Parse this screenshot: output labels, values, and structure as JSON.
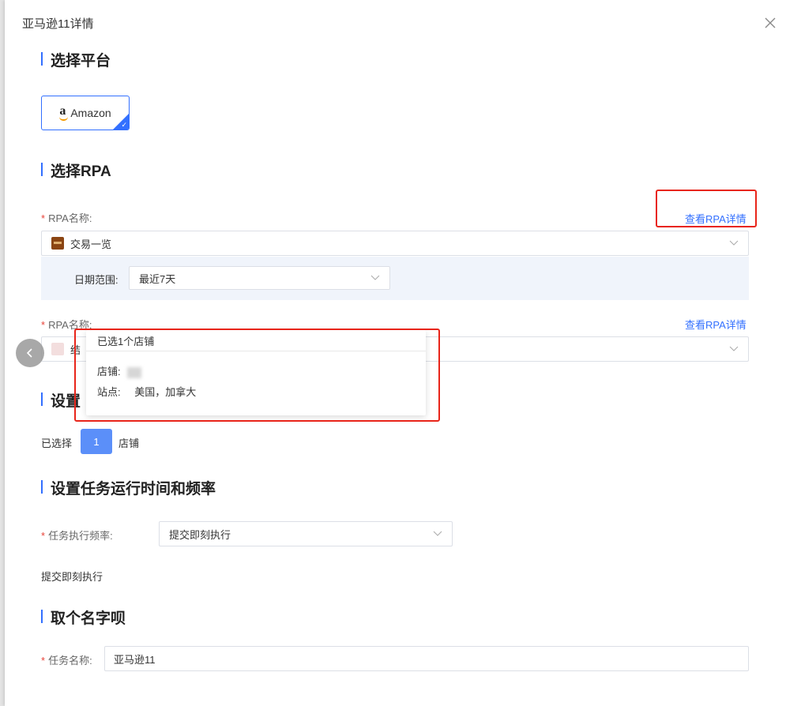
{
  "modal": {
    "title": "亚马逊11详情"
  },
  "sections": {
    "platform": "选择平台",
    "rpa": "选择RPA",
    "settings_partial": "设置",
    "schedule": "设置任务运行时间和频率",
    "name": "取个名字呗"
  },
  "platform": {
    "selected_label": "Amazon",
    "icon": "amazon-logo-icon"
  },
  "rpa": [
    {
      "label": "RPA名称:",
      "link": "查看RPA详情",
      "value": "交易一览",
      "date_range_label": "日期范围:",
      "date_range_value": "最近7天"
    },
    {
      "label": "RPA名称:",
      "link": "查看RPA详情",
      "value_partial": "结"
    }
  ],
  "popover": {
    "title": "已选1个店铺",
    "store_label": "店铺:",
    "site_label": "站点:",
    "site_value": "美国，加拿大"
  },
  "stores": {
    "prefix": "已选择",
    "count": "1",
    "suffix": "店铺"
  },
  "schedule": {
    "label": "任务执行频率:",
    "value": "提交即刻执行",
    "description": "提交即刻执行"
  },
  "task_name": {
    "label": "任务名称:",
    "value": "亚马逊11"
  },
  "colors": {
    "accent": "#3370ff",
    "annotation_red": "#e8251a",
    "required": "#e8443a"
  }
}
